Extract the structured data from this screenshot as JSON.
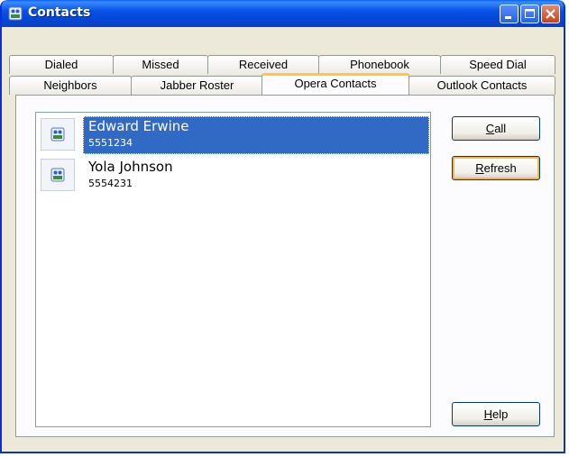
{
  "window": {
    "title": "Contacts"
  },
  "tabs": {
    "row1": [
      {
        "label": "Dialed"
      },
      {
        "label": "Missed"
      },
      {
        "label": "Received"
      },
      {
        "label": "Phonebook"
      },
      {
        "label": "Speed Dial"
      }
    ],
    "row2": [
      {
        "label": "Neighbors"
      },
      {
        "label": "Jabber Roster"
      },
      {
        "label": "Opera Contacts",
        "active": true
      },
      {
        "label": "Outlook Contacts"
      }
    ]
  },
  "contacts": [
    {
      "name": "Edward Erwine",
      "number": "5551234",
      "selected": true
    },
    {
      "name": "Yola Johnson",
      "number": "5554231",
      "selected": false
    }
  ],
  "buttons": {
    "call": {
      "mnemonic": "C",
      "rest": "all"
    },
    "refresh": {
      "mnemonic": "R",
      "rest": "efresh"
    },
    "help": {
      "mnemonic": "H",
      "rest": "elp"
    }
  },
  "icons": {
    "title": "contacts-icon",
    "contact": "contact-card-icon"
  },
  "colors": {
    "titlebar": "#0a4fdf",
    "selection": "#316ac5",
    "active_tab_accent": "#ffc83c",
    "close_button": "#c8401c"
  }
}
